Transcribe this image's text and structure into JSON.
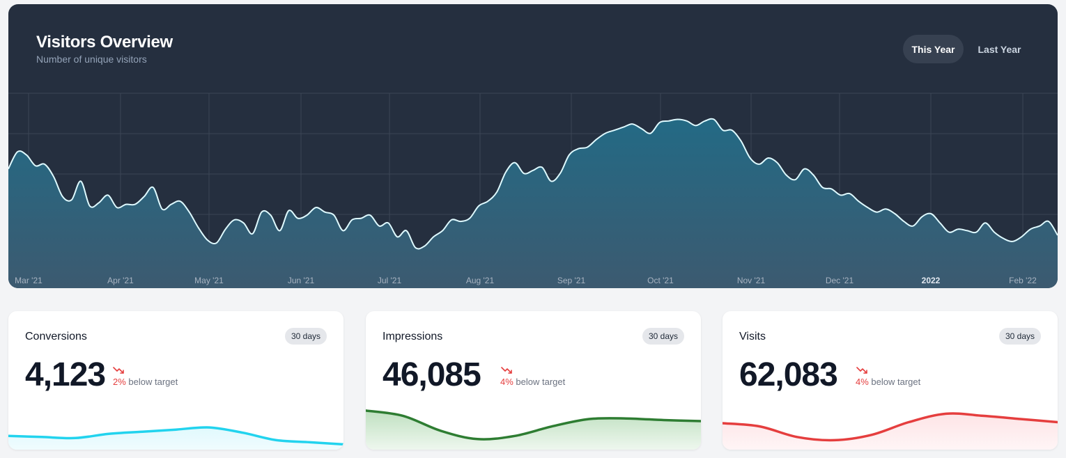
{
  "overview": {
    "title": "Visitors Overview",
    "subtitle": "Number of unique visitors",
    "buttons": {
      "this_year": "This Year",
      "last_year": "Last Year"
    }
  },
  "chart_data": {
    "type": "area",
    "x_start": "2021-03-01",
    "x_end": "2022-02-28",
    "ticks": [
      "Mar '21",
      "Apr '21",
      "May '21",
      "Jun '21",
      "Jul '21",
      "Aug '21",
      "Sep '21",
      "Oct '21",
      "Nov '21",
      "Dec '21",
      "2022",
      "Feb '22"
    ],
    "bold_ticks": [
      "2022"
    ],
    "ylim": [
      0,
      100
    ],
    "grid": true,
    "series": [
      {
        "values": [
          61,
          72,
          70,
          63,
          64,
          56,
          43,
          41,
          53,
          37,
          39,
          44,
          36,
          38,
          38,
          43,
          49,
          35,
          38,
          40,
          33,
          23,
          15,
          13,
          22,
          28,
          26,
          19,
          33,
          31,
          21,
          34,
          29,
          31,
          36,
          33,
          31,
          21,
          28,
          29,
          31,
          24,
          26,
          17,
          21,
          10,
          11,
          17,
          21,
          28,
          27,
          29,
          37,
          40,
          46,
          59,
          65,
          58,
          60,
          62,
          53,
          58,
          70,
          74,
          75,
          80,
          84,
          86,
          88,
          90,
          87,
          84,
          91,
          92,
          93,
          92,
          89,
          92,
          93,
          86,
          86,
          79,
          68,
          64,
          68,
          65,
          57,
          54,
          61,
          57,
          49,
          48,
          44,
          45,
          40,
          36,
          33,
          35,
          32,
          27,
          24,
          30,
          32,
          26,
          20,
          22,
          21,
          20,
          26,
          20,
          16,
          14,
          17,
          22,
          24,
          27,
          18
        ]
      }
    ],
    "colors": {
      "line": "#dffaff",
      "area_top": "#236a85",
      "area_bottom": "#3c5a70",
      "grid": "#3b4656"
    }
  },
  "cards": [
    {
      "title": "Conversions",
      "badge": "30 days",
      "value": "4,123",
      "trend_pct": "2%",
      "trend_text": "below target",
      "trend_icon": "trend-down-icon",
      "spark_values": [
        22,
        20,
        18,
        26,
        30,
        34,
        38,
        28,
        14,
        10,
        6
      ],
      "colors": {
        "line": "#22d3ee",
        "fill_top": "#e0f9fd",
        "fill_bottom": "#f0fcfe"
      }
    },
    {
      "title": "Impressions",
      "badge": "30 days",
      "value": "46,085",
      "trend_pct": "4%",
      "trend_text": "below target",
      "trend_icon": "trend-down-icon",
      "spark_values": [
        70,
        60,
        32,
        16,
        22,
        40,
        54,
        55,
        52,
        50
      ],
      "colors": {
        "line": "#2e7d32",
        "fill_top": "#bfe0c0",
        "fill_bottom": "#eef7ee"
      }
    },
    {
      "title": "Visits",
      "badge": "30 days",
      "value": "62,083",
      "trend_pct": "4%",
      "trend_text": "below target",
      "trend_icon": "trend-down-icon",
      "spark_values": [
        46,
        40,
        20,
        14,
        24,
        48,
        64,
        60,
        54,
        48
      ],
      "colors": {
        "line": "#e53e3e",
        "fill_top": "#fde4e6",
        "fill_bottom": "#fff5f6"
      }
    }
  ]
}
